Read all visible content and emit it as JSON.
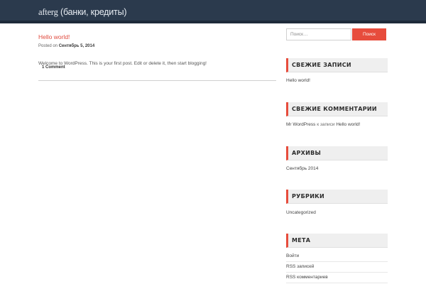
{
  "header": {
    "site_title_prefix": "afterg",
    "site_title_rest": "(банки, кредиты)",
    "colors": {
      "background": "#2b3a4d",
      "accent": "#e74c3c"
    }
  },
  "post": {
    "title": "Hello world!",
    "meta_prefix": "Posted on",
    "date": "Сентябрь 5, 2014",
    "content": "Welcome to WordPress. This is your first post. Edit or delete it, then start blogging!",
    "comments_link": "1 Comment"
  },
  "search": {
    "placeholder": "Поиск…",
    "button_label": "Поиск"
  },
  "widgets": {
    "recent_posts": {
      "title": "СВЕЖИЕ ЗАПИСИ",
      "items": [
        "Hello world!"
      ]
    },
    "recent_comments": {
      "title": "СВЕЖИЕ КОММЕНТАРИИ",
      "author": "Mr WordPress",
      "connector": "к записи",
      "post": "Hello world!"
    },
    "archives": {
      "title": "АРХИВЫ",
      "items": [
        "Сентябрь 2014"
      ]
    },
    "categories": {
      "title": "РУБРИКИ",
      "items": [
        "Uncategorized"
      ]
    },
    "meta": {
      "title": "МЕТА",
      "items": [
        "Войти",
        "RSS записей",
        "RSS комментариев"
      ]
    }
  }
}
